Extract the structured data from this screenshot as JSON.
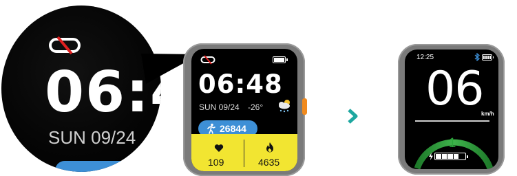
{
  "magnifier": {
    "time": "06:4",
    "date": "SUN 09/24"
  },
  "watch_face": {
    "time": "06:48",
    "date": "SUN 09/24",
    "temperature": "-26°",
    "steps": "26844",
    "heart_rate": "109",
    "calories": "4635",
    "icons": [
      "link-off-icon",
      "battery-icon",
      "weather-snow-cloud-icon",
      "running-icon",
      "heart-icon",
      "flame-icon"
    ]
  },
  "speed_face": {
    "clock": "12:25",
    "speed": "06",
    "unit": "km/h",
    "assist_level": "1",
    "battery_segments_total": 5,
    "battery_segments_filled": 4,
    "icons": [
      "bluetooth-icon",
      "battery-icon",
      "charging-bolt-icon"
    ]
  },
  "colors": {
    "accent_blue": "#3d8fd6",
    "panel_yellow": "#f2e531",
    "crown_orange": "#f08a1e",
    "arrow_teal": "#1ea7a0",
    "gauge_green": "#2aa63a",
    "unlink_red": "#e02020",
    "case_gray": "#7a7a7a"
  }
}
